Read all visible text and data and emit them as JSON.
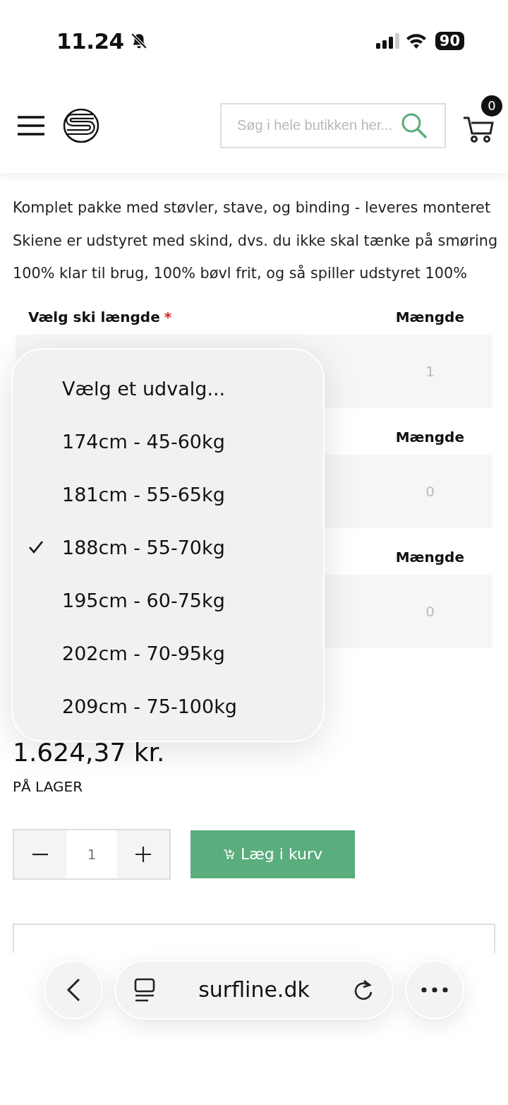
{
  "status_bar": {
    "time": "11.24",
    "battery": "90"
  },
  "header": {
    "search": {
      "placeholder": "Søg i hele butikken her..."
    },
    "cart_count": "0"
  },
  "description": [
    "Komplet pakke med støvler, stave, og binding - leveres monteret",
    "Skiene er udstyret med skind, dvs. du ikke skal tænke på smøring",
    "100% klar til brug, 100% bøvl frit, og så spiller udstyret 100%"
  ],
  "options_table": {
    "label": "Vælg ski længde",
    "required_mark": "*",
    "rows": [
      {
        "quantity_header": "Mængde",
        "quantity": "1"
      },
      {
        "quantity_header": "Mængde",
        "quantity": "0"
      },
      {
        "quantity_header": "Mængde",
        "quantity": "0"
      }
    ]
  },
  "dropdown": {
    "options": [
      {
        "label": "Vælg et udvalg...",
        "selected": false
      },
      {
        "label": "174cm - 45-60kg",
        "selected": false
      },
      {
        "label": "181cm - 55-65kg",
        "selected": false
      },
      {
        "label": "188cm - 55-70kg",
        "selected": true
      },
      {
        "label": "195cm - 60-75kg",
        "selected": false
      },
      {
        "label": "202cm - 70-95kg",
        "selected": false
      },
      {
        "label": "209cm - 75-100kg",
        "selected": false
      }
    ]
  },
  "price": "1.624,37 kr.",
  "stock": "PÅ LAGER",
  "quantity": "1",
  "add_to_cart": "Læg i kurv",
  "browser": {
    "url": "surfline.dk"
  }
}
